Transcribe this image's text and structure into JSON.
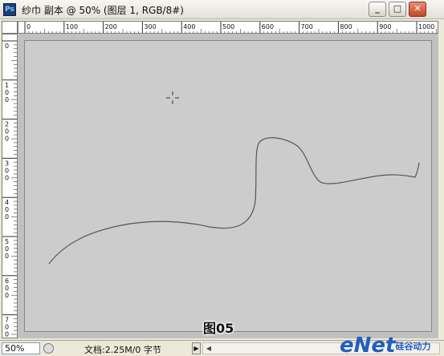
{
  "window": {
    "app_icon": "Ps",
    "title": "纱巾 副本 @ 50% (图层 1, RGB/8#)",
    "controls": {
      "minimize": "_",
      "maximize": "□",
      "close": "✕"
    }
  },
  "ruler": {
    "horizontal_labels": [
      "0",
      "100",
      "200",
      "300",
      "400",
      "500",
      "600",
      "700",
      "800",
      "900",
      "1000"
    ],
    "vertical_labels": [
      "0",
      "1 0 0",
      "2 0 0",
      "3 0 0",
      "4 0 0",
      "5 0 0",
      "6 0 0",
      "7 0 0"
    ]
  },
  "canvas": {
    "caption": "图05",
    "background_color": "#cccccc",
    "stroke_color": "#555555"
  },
  "statusbar": {
    "zoom": "50%",
    "doc_info": "文档:2.25M/0 字节",
    "arrow": "▶",
    "scroll_left": "◀"
  },
  "watermark": {
    "brand": "eNet",
    "sub": "硅谷动力"
  }
}
